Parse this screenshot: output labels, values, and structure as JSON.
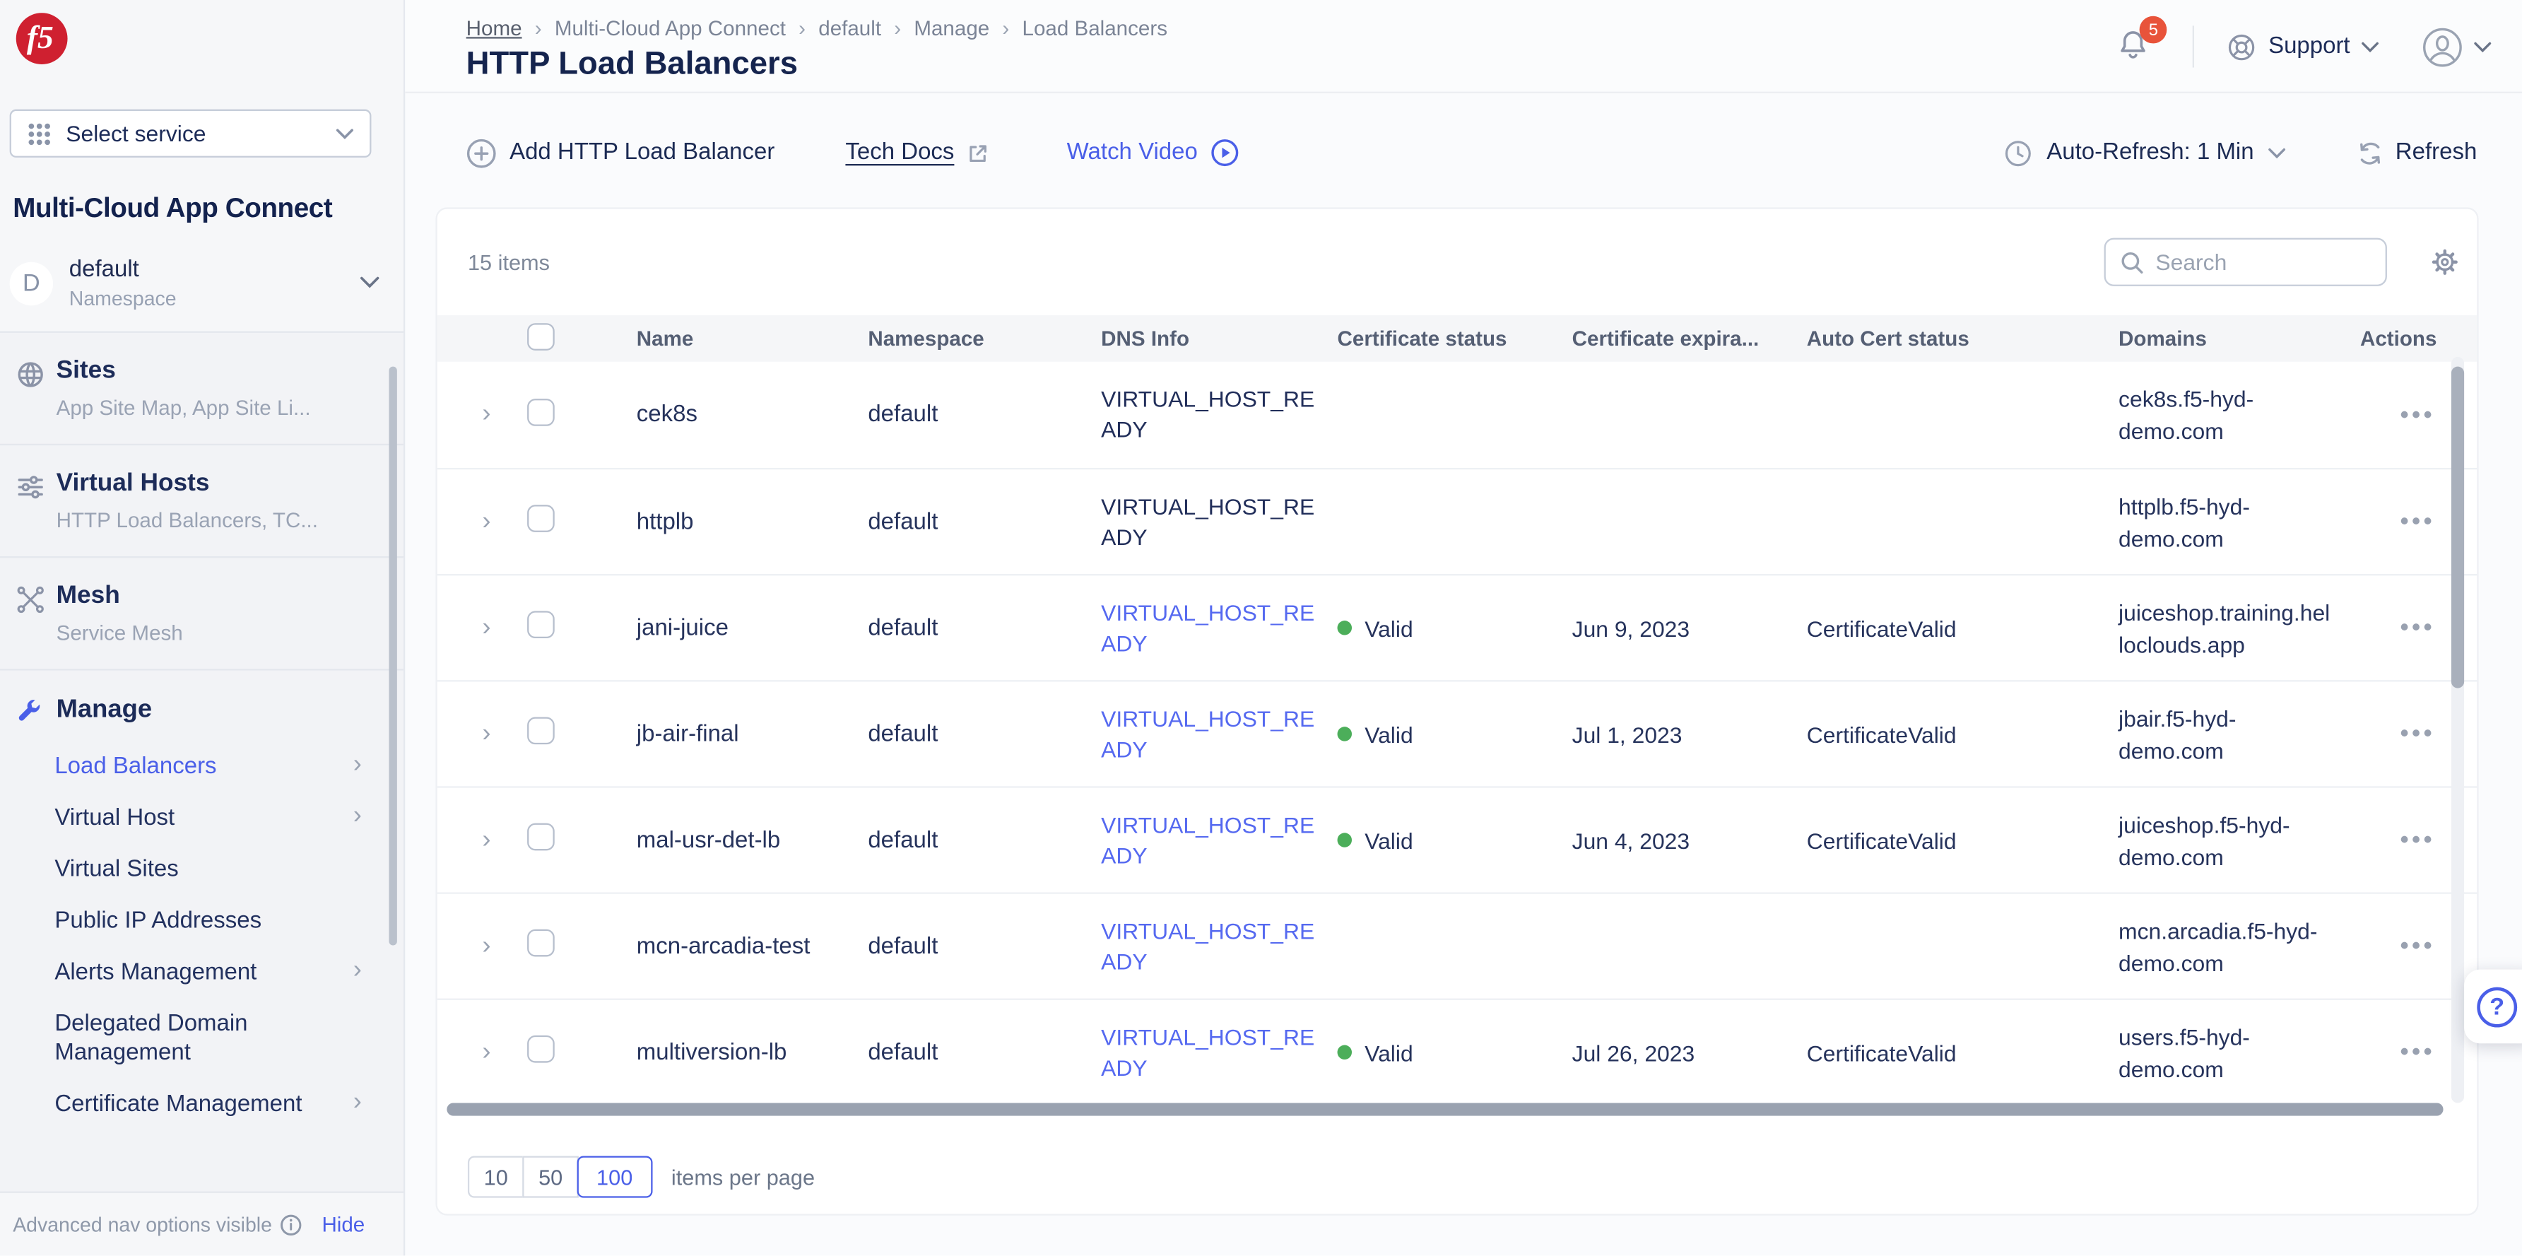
{
  "brand": {
    "logo_text": "f5"
  },
  "sidebar": {
    "service_selector": {
      "label": "Select service"
    },
    "app_title": "Multi-Cloud App Connect",
    "namespace": {
      "initial": "D",
      "name": "default",
      "type_label": "Namespace"
    },
    "sections": [
      {
        "label": "Sites",
        "sublabel": "App Site Map, App Site Li...",
        "icon": "globe-icon"
      },
      {
        "label": "Virtual Hosts",
        "sublabel": "HTTP Load Balancers, TC...",
        "icon": "sliders-icon"
      },
      {
        "label": "Mesh",
        "sublabel": "Service Mesh",
        "icon": "mesh-icon"
      }
    ],
    "manage": {
      "label": "Manage",
      "items": [
        {
          "label": "Load Balancers",
          "active": true,
          "has_children": true
        },
        {
          "label": "Virtual Host",
          "active": false,
          "has_children": true
        },
        {
          "label": "Virtual Sites",
          "active": false,
          "has_children": false
        },
        {
          "label": "Public IP Addresses",
          "active": false,
          "has_children": false
        },
        {
          "label": "Alerts Management",
          "active": false,
          "has_children": true
        },
        {
          "label": "Delegated Domain Management",
          "active": false,
          "has_children": false
        },
        {
          "label": "Certificate Management",
          "active": false,
          "has_children": true
        }
      ]
    },
    "footer": {
      "status_text": "Advanced nav options visible",
      "hide_label": "Hide"
    }
  },
  "header": {
    "breadcrumb": [
      "Home",
      "Multi-Cloud App Connect",
      "default",
      "Manage",
      "Load Balancers"
    ],
    "title": "HTTP Load Balancers",
    "notifications_count": "5",
    "support_label": "Support"
  },
  "toolbar": {
    "add_label": "Add HTTP Load Balancer",
    "tech_docs_label": "Tech Docs",
    "watch_video_label": "Watch Video",
    "auto_refresh_label": "Auto-Refresh: 1 Min",
    "refresh_label": "Refresh"
  },
  "table": {
    "items_count": "15 items",
    "search_placeholder": "Search",
    "columns": [
      "Name",
      "Namespace",
      "DNS Info",
      "Certificate status",
      "Certificate expira...",
      "Auto Cert status",
      "Domains",
      "Actions"
    ],
    "rows": [
      {
        "name": "cek8s",
        "namespace": "default",
        "dns_info": "VIRTUAL_HOST_READY",
        "dns_is_link": false,
        "cert_status": "",
        "cert_expiry": "",
        "auto_cert": "",
        "domain": "cek8s.f5-hyd-demo.com"
      },
      {
        "name": "httplb",
        "namespace": "default",
        "dns_info": "VIRTUAL_HOST_READY",
        "dns_is_link": false,
        "cert_status": "",
        "cert_expiry": "",
        "auto_cert": "",
        "domain": "httplb.f5-hyd-demo.com"
      },
      {
        "name": "jani-juice",
        "namespace": "default",
        "dns_info": "VIRTUAL_HOST_READY",
        "dns_is_link": true,
        "cert_status": "Valid",
        "cert_expiry": "Jun 9, 2023",
        "auto_cert": "CertificateValid",
        "domain": "juiceshop.training.helloclouds.app"
      },
      {
        "name": "jb-air-final",
        "namespace": "default",
        "dns_info": "VIRTUAL_HOST_READY",
        "dns_is_link": true,
        "cert_status": "Valid",
        "cert_expiry": "Jul 1, 2023",
        "auto_cert": "CertificateValid",
        "domain": "jbair.f5-hyd-demo.com"
      },
      {
        "name": "mal-usr-det-lb",
        "namespace": "default",
        "dns_info": "VIRTUAL_HOST_READY",
        "dns_is_link": true,
        "cert_status": "Valid",
        "cert_expiry": "Jun 4, 2023",
        "auto_cert": "CertificateValid",
        "domain": "juiceshop.f5-hyd-demo.com"
      },
      {
        "name": "mcn-arcadia-test",
        "namespace": "default",
        "dns_info": "VIRTUAL_HOST_READY",
        "dns_is_link": true,
        "cert_status": "",
        "cert_expiry": "",
        "auto_cert": "",
        "domain": "mcn.arcadia.f5-hyd-demo.com"
      },
      {
        "name": "multiversion-lb",
        "namespace": "default",
        "dns_info": "VIRTUAL_HOST_READY",
        "dns_is_link": true,
        "cert_status": "Valid",
        "cert_expiry": "Jul 26, 2023",
        "auto_cert": "CertificateValid",
        "domain": "users.f5-hyd-demo.com"
      }
    ]
  },
  "pagination": {
    "options": [
      "10",
      "50",
      "100"
    ],
    "selected": "100",
    "label": "items per page"
  },
  "colors": {
    "accent_blue": "#4a5fe8",
    "link_blue": "#5569f0",
    "status_green": "#4cae5a",
    "badge_red": "#e8533a",
    "logo_red": "#cf2030",
    "navy": "#15244e"
  }
}
